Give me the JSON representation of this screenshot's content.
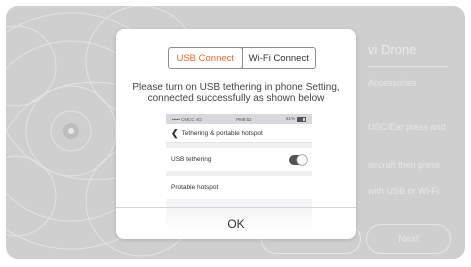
{
  "background": {
    "title": "vi Drone",
    "lines": [
      "Accessories",
      "USC/Ear press and",
      "aircraft then press",
      "with USB or Wi-Fi"
    ],
    "next_label": "Next"
  },
  "dialog": {
    "tabs": [
      {
        "label": "USB Connect",
        "active": true
      },
      {
        "label": "Wi-Fi Connect",
        "active": false
      }
    ],
    "instruction_line1": "Please turn on USB tethering in phone Setting,",
    "instruction_line2": "connected successfully as shown below",
    "phone": {
      "status_left": "••••• CMCC 4G",
      "status_time": "PM8:52",
      "status_battery": "81%",
      "nav_title": "Tethering & portable hotspot",
      "row1_label": "USB tethering",
      "row1_toggle_on": true,
      "row2_label": "Protable hotspot"
    },
    "ok_label": "OK"
  },
  "colors": {
    "accent": "#e8692a",
    "overlay": "#cfcfcf"
  }
}
